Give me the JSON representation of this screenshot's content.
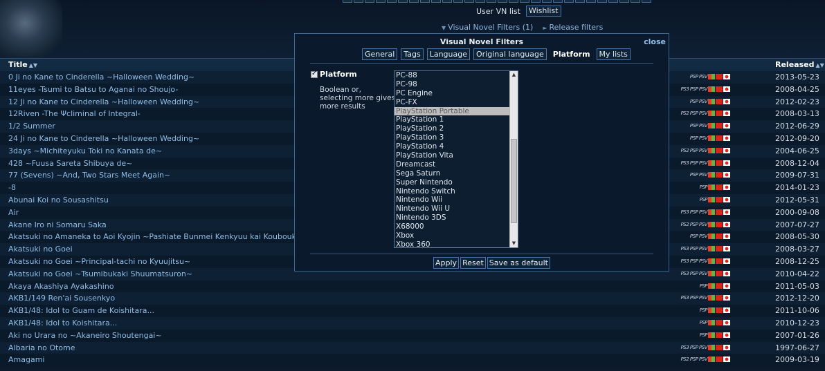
{
  "header": {
    "user_vn_list": "User VN list",
    "wishlist": "Wishlist",
    "vn_filters": "Visual Novel Filters (1)",
    "release_filters": "Release filters"
  },
  "table": {
    "col_title": "Title",
    "col_released": "Released",
    "rows": [
      {
        "title": "0 Ji no Kane to Cinderella ~Halloween Wedding~",
        "date": "2013-05-23",
        "plat": "PSP PSV"
      },
      {
        "title": "11eyes -Tsumi to Batsu to Aganai no Shoujo-",
        "date": "2008-04-25",
        "plat": "PS3 PSP PSV"
      },
      {
        "title": "12 Ji no Kane to Cinderella ~Halloween Wedding~",
        "date": "2012-02-23",
        "plat": "PSP PSV"
      },
      {
        "title": "12Riven -The Ψcliminal of Integral-",
        "date": "2008-03-13",
        "plat": "PS2 PSP PSV"
      },
      {
        "title": "1/2 Summer",
        "date": "2012-06-29",
        "plat": "PSP PSV"
      },
      {
        "title": "24 Ji no Kane to Cinderella ~Halloween Wedding~",
        "date": "2012-09-20",
        "plat": "PSP PSV"
      },
      {
        "title": "3days ~Michiteyuku Toki no Kanata de~",
        "date": "2004-06-25",
        "plat": "PS2 PSP PSV"
      },
      {
        "title": "428 ~Fuusa Sareta Shibuya de~",
        "date": "2008-12-04",
        "plat": "PS3 PSP PSV"
      },
      {
        "title": "77 (Sevens) ~And, Two Stars Meet Again~",
        "date": "2009-07-31",
        "plat": "PSP PSV"
      },
      {
        "title": "-8",
        "date": "2014-01-23",
        "plat": "PSP"
      },
      {
        "title": "Abunai Koi no Sousashitsu",
        "date": "2012-05-31",
        "plat": "PSP"
      },
      {
        "title": "Air",
        "date": "2000-09-08",
        "plat": "PS3 PSP PSV"
      },
      {
        "title": "Akane Iro ni Somaru Saka",
        "date": "2007-07-27",
        "plat": "PS2 PSP PSV"
      },
      {
        "title": "Akatsuki no Amaneka to Aoi Kyojin ~Pashiate Bunmei Kenkyuu kai Koubouki~",
        "date": "2008-05-30",
        "plat": "PSP PSV"
      },
      {
        "title": "Akatsuki no Goei",
        "date": "2008-03-27",
        "plat": "PS3 PSP PSV"
      },
      {
        "title": "Akatsuki no Goei ~Principal-tachi no Kyuujitsu~",
        "date": "2008-12-25",
        "plat": "PS3 PSP PSV"
      },
      {
        "title": "Akatsuki no Goei ~Tsumibukaki Shuumatsuron~",
        "date": "2010-04-22",
        "plat": "PS3 PSP PSV"
      },
      {
        "title": "Akaya Akashiya Ayakashino",
        "date": "2011-05-03",
        "plat": "PSP"
      },
      {
        "title": "AKB1/149 Ren'ai Sousenkyo",
        "date": "2012-12-20",
        "plat": "PS3 PSP PSV"
      },
      {
        "title": "AKB1/48: Idol to Guam de Koishitara...",
        "date": "2011-10-06",
        "plat": "PSP"
      },
      {
        "title": "AKB1/48: Idol to Koishitara...",
        "date": "2010-12-23",
        "plat": "PSP"
      },
      {
        "title": "Aki no Urara no ~Akaneiro Shoutengai~",
        "date": "2007-01-26",
        "plat": "PSP"
      },
      {
        "title": "Albaria no Otome",
        "date": "1997-06-27",
        "plat": "PS3 PSP PSV"
      },
      {
        "title": "Amagami",
        "date": "2009-03-19",
        "plat": "PS2 PSP PSV"
      }
    ]
  },
  "popup": {
    "title": "Visual Novel Filters",
    "close": "close",
    "tabs": [
      "General",
      "Tags",
      "Language",
      "Original language",
      "Platform",
      "My lists"
    ],
    "active_tab": "Platform",
    "filter_label": "Platform",
    "filter_desc": "Boolean or, selecting more gives more results",
    "options": [
      "PC-88",
      "PC-98",
      "PC Engine",
      "PC-FX",
      "PlayStation Portable",
      "PlayStation 1",
      "PlayStation 2",
      "PlayStation 3",
      "PlayStation 4",
      "PlayStation Vita",
      "Dreamcast",
      "Sega Saturn",
      "Super Nintendo",
      "Nintendo Switch",
      "Nintendo Wii",
      "Nintendo Wii U",
      "Nintendo 3DS",
      "X68000",
      "Xbox",
      "Xbox 360"
    ],
    "selected_option": "PlayStation Portable",
    "buttons": {
      "apply": "Apply",
      "reset": "Reset",
      "save": "Save as default"
    }
  }
}
